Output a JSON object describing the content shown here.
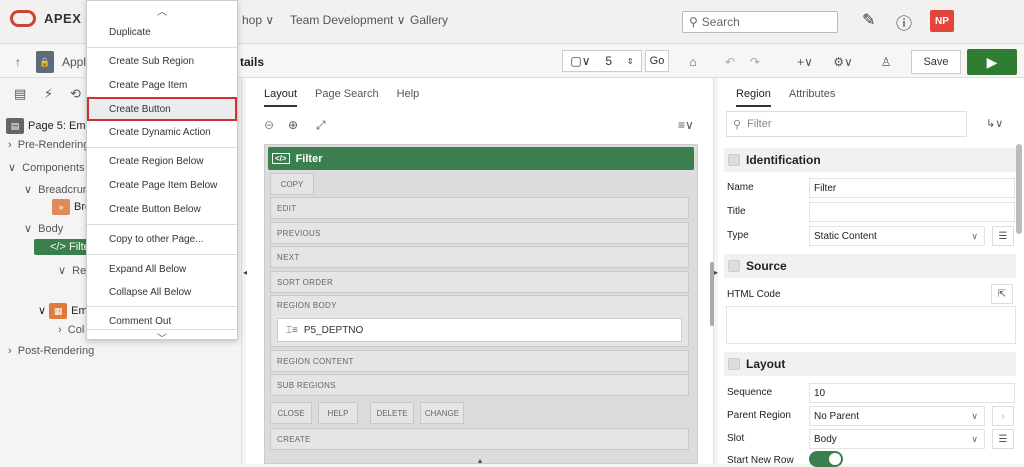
{
  "header": {
    "brand": "APEX",
    "nav_items": [
      "hop ∨",
      "Team Development ∨",
      "Gallery"
    ],
    "search_placeholder": "Search",
    "user_initials": "NP",
    "brand_color": "#c74634"
  },
  "toolbar": {
    "app_label": "Appli",
    "page_title_fragment": "tails",
    "page_number": "5",
    "go_label": "Go",
    "save_label": "Save"
  },
  "tree": {
    "page_label": "Page 5: Employ",
    "pre_rendering": "Pre-Rendering",
    "components": "Components",
    "breadcrumb": "Breadcrum",
    "breadcrumb_child": "Bre",
    "body": "Body",
    "filter": "Filte",
    "region_child": "Re",
    "employees": "Em",
    "columns": "Col",
    "post_rendering": "Post-Rendering"
  },
  "context_menu": {
    "items": [
      "Duplicate",
      "Create Sub Region",
      "Create Page Item",
      "Create Button",
      "Create Dynamic Action",
      "Create Region Below",
      "Create Page Item Below",
      "Create Button Below",
      "Copy to other Page...",
      "Expand All Below",
      "Collapse All Below",
      "Comment Out"
    ],
    "highlighted": "Create Button"
  },
  "layout_panel": {
    "tabs": [
      "Layout",
      "Page Search",
      "Help"
    ],
    "active_tab": "Layout",
    "region_title": "Filter",
    "slots": {
      "copy": "COPY",
      "edit": "EDIT",
      "previous": "PREVIOUS",
      "next": "NEXT",
      "sort_order": "SORT ORDER",
      "region_body": "REGION BODY",
      "region_content": "REGION CONTENT",
      "sub_regions": "SUB REGIONS",
      "close": "CLOSE",
      "help": "HELP",
      "delete": "DELETE",
      "change": "CHANGE",
      "create": "CREATE"
    },
    "page_item": "P5_DEPTNO"
  },
  "property_panel": {
    "tabs": [
      "Region",
      "Attributes"
    ],
    "active_tab": "Region",
    "filter_placeholder": "Filter",
    "identification": {
      "heading": "Identification",
      "name_label": "Name",
      "name_value": "Filter",
      "title_label": "Title",
      "title_value": "",
      "type_label": "Type",
      "type_value": "Static Content"
    },
    "source": {
      "heading": "Source",
      "html_code_label": "HTML Code"
    },
    "layout": {
      "heading": "Layout",
      "sequence_label": "Sequence",
      "sequence_value": "10",
      "parent_region_label": "Parent Region",
      "parent_region_value": "No Parent",
      "slot_label": "Slot",
      "slot_value": "Body",
      "start_new_row_label": "Start New Row",
      "start_new_row_value": true
    },
    "accent_color": "#3b7f4f"
  }
}
